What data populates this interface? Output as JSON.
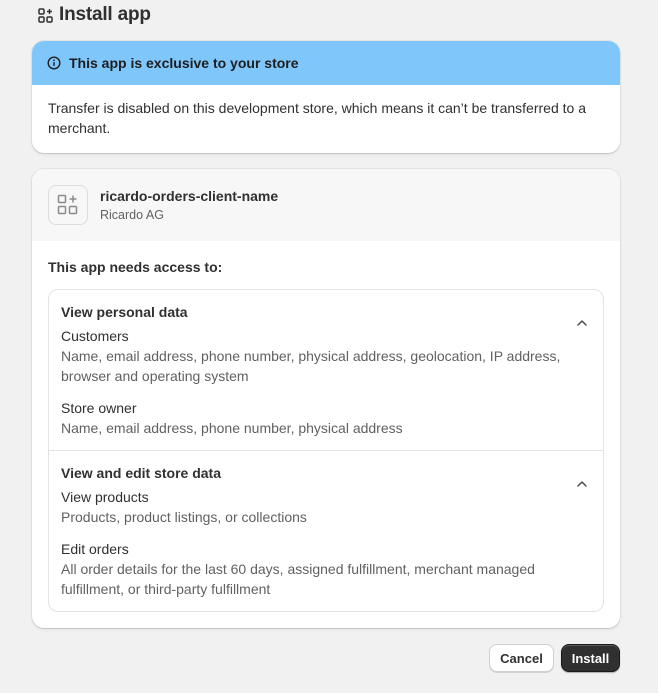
{
  "header": {
    "title": "Install app",
    "icon": "apps-icon"
  },
  "banner": {
    "title": "This app is exclusive to your store",
    "icon": "info-icon",
    "body": "Transfer is disabled on this development store, which means it can’t be transferred to a merchant.",
    "color": "#7fc6fa"
  },
  "app": {
    "name": "ricardo-orders-client-name",
    "developer": "Ricardo AG",
    "icon": "app-placeholder-icon"
  },
  "access": {
    "title": "This app needs access to:",
    "sections": [
      {
        "title": "View personal data",
        "items": [
          {
            "label": "Customers",
            "desc": "Name, email address, phone number, physical address, geolocation, IP address, browser and operating system"
          },
          {
            "label": "Store owner",
            "desc": "Name, email address, phone number, physical address"
          }
        ]
      },
      {
        "title": "View and edit store data",
        "items": [
          {
            "label": "View products",
            "desc": "Products, product listings, or collections"
          },
          {
            "label": "Edit orders",
            "desc": "All order details for the last 60 days, assigned fulfillment, merchant managed fulfillment, or third-party fulfillment"
          }
        ]
      }
    ]
  },
  "buttons": {
    "cancel": "Cancel",
    "install": "Install"
  }
}
